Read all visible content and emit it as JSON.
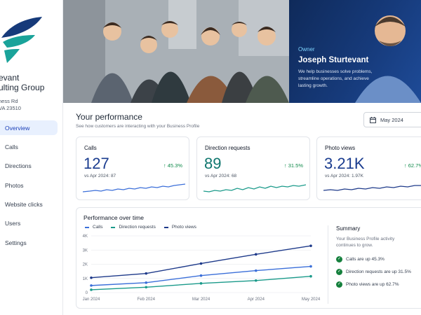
{
  "sidebar": {
    "brand_line1": "evant",
    "brand_line2": "ulting Group",
    "address_line1": "ness Rd",
    "address_line2": "VA 23510",
    "items": [
      {
        "label": "Overview",
        "active": true
      },
      {
        "label": "Calls"
      },
      {
        "label": "Directions"
      },
      {
        "label": "Photos"
      },
      {
        "label": "Website clicks"
      },
      {
        "label": "Users"
      },
      {
        "label": "Settings"
      }
    ]
  },
  "hero": {
    "owner_label": "Owner",
    "owner_name": "Joseph Sturtevant",
    "owner_description": "We help businesses solve problems, streamline operations, and achieve lasting growth."
  },
  "performance": {
    "title": "Your performance",
    "subtitle": "See how customers are interacting with your Business Profile",
    "date_selector": "May 2024"
  },
  "cards": [
    {
      "title": "Calls",
      "value": "127",
      "change": "45.3%",
      "previous": "vs Apr 2024: 87"
    },
    {
      "title": "Direction requests",
      "value": "89",
      "change": "31.5%",
      "previous": "vs Apr 2024: 68"
    },
    {
      "title": "Photo views",
      "value": "3.21K",
      "change": "62.7%",
      "previous": "vs Apr 2024: 1.97K"
    }
  ],
  "colors": {
    "calls": "#3b6fd9",
    "directions": "#1a9a8a",
    "photos": "#1e3a8a",
    "positive": "#0f8a4a"
  },
  "panel": {
    "title": "Performance over time",
    "legend": [
      "Calls",
      "Direction requests",
      "Photo views"
    ]
  },
  "chart_data": {
    "type": "line",
    "x": [
      "Jan 2024",
      "Feb 2024",
      "Mar 2024",
      "Apr 2024",
      "May 2024"
    ],
    "ytick_labels": [
      "0",
      "1K",
      "2K",
      "3K",
      "4K"
    ],
    "ylim": [
      0,
      4000
    ],
    "grid": true,
    "series": [
      {
        "name": "Calls",
        "values": [
          500,
          700,
          1200,
          1550,
          1850
        ]
      },
      {
        "name": "Direction requests",
        "values": [
          200,
          380,
          650,
          850,
          1150
        ]
      },
      {
        "name": "Photo views",
        "values": [
          1050,
          1350,
          2050,
          2700,
          3300
        ]
      }
    ]
  },
  "summary": {
    "title": "Summary",
    "subtitle": "Your Business Profile activity continues to grow.",
    "items": [
      "Calls are up 45.3%",
      "Direction requests are up 31.5%",
      "Photo views are up 62.7%"
    ]
  }
}
